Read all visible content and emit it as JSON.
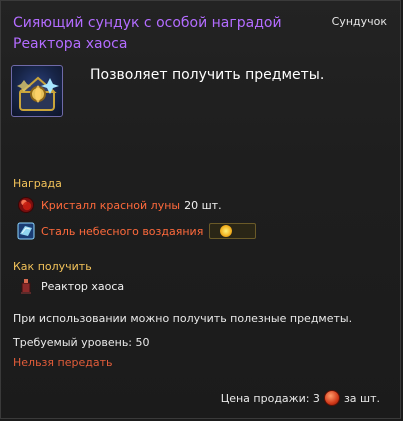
{
  "tooltip": {
    "title": "Сияющий сундук с особой наградой Реактора хаоса",
    "item_type": "Сундучок",
    "icon": "treasure-chest-icon",
    "description": "Позволяет получить предметы.",
    "reward_section": "Награда",
    "rewards": [
      {
        "icon": "red-moon-crystal-icon",
        "name": "Кристалл красной луны",
        "amount": "20 шт."
      },
      {
        "icon": "heaven-steel-icon",
        "name": "Сталь небесного воздаяния",
        "badge_icon": "gold-coin-icon"
      }
    ],
    "obtain_section": "Как получить",
    "obtain_source": {
      "icon": "reactor-icon",
      "name": "Реактор хаоса"
    },
    "usage_text": "При использовании можно получить полезные предметы.",
    "required_level": "Требуемый уровень: 50",
    "untradeable": "Нельзя передать",
    "price": {
      "label": "Цена продажи: 3",
      "suffix": "за шт.",
      "icon": "copper-coin-icon"
    }
  },
  "colors": {
    "title": "#b36cff",
    "section": "#f3c35a",
    "reward_name": "#ff6a3c",
    "warning": "#e35d3a"
  }
}
